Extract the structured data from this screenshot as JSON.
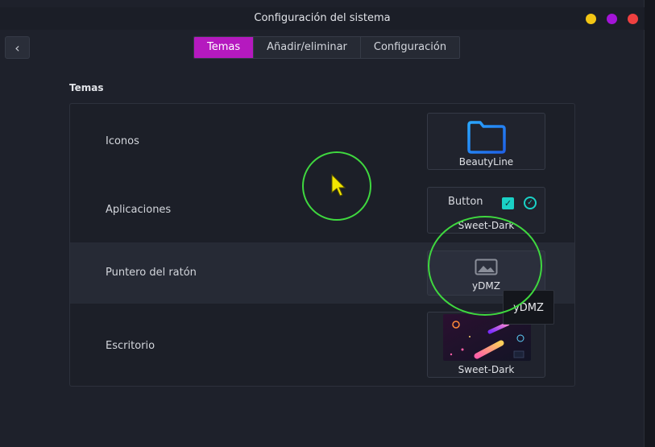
{
  "window": {
    "title": "Configuración del sistema",
    "controls": {
      "minimize_color": "#f2c514",
      "maximize_color": "#a314d8",
      "close_color": "#ef4040"
    }
  },
  "nav": {
    "back_glyph": "‹"
  },
  "tabs": [
    {
      "label": "Temas",
      "active": true
    },
    {
      "label": "Añadir/eliminar",
      "active": false
    },
    {
      "label": "Configuración",
      "active": false
    }
  ],
  "section": {
    "title": "Temas"
  },
  "rows": [
    {
      "label": "Iconos",
      "value": "BeautyLine",
      "icon": "folder-icon"
    },
    {
      "label": "Aplicaciones",
      "value": "Sweet-Dark",
      "preview_button_label": "Button",
      "check_glyph": "✓"
    },
    {
      "label": "Puntero del ratón",
      "value": "yDMZ",
      "icon": "image-placeholder-icon"
    },
    {
      "label": "Escritorio",
      "value": "Sweet-Dark",
      "icon": "wallpaper-thumbnail"
    }
  ],
  "tooltip": {
    "text": "yDMZ"
  },
  "colors": {
    "accent": "#b519bf",
    "highlight": "#1ad1c6",
    "annotation_ring": "#3fd83f",
    "cursor": "#f2e600"
  }
}
